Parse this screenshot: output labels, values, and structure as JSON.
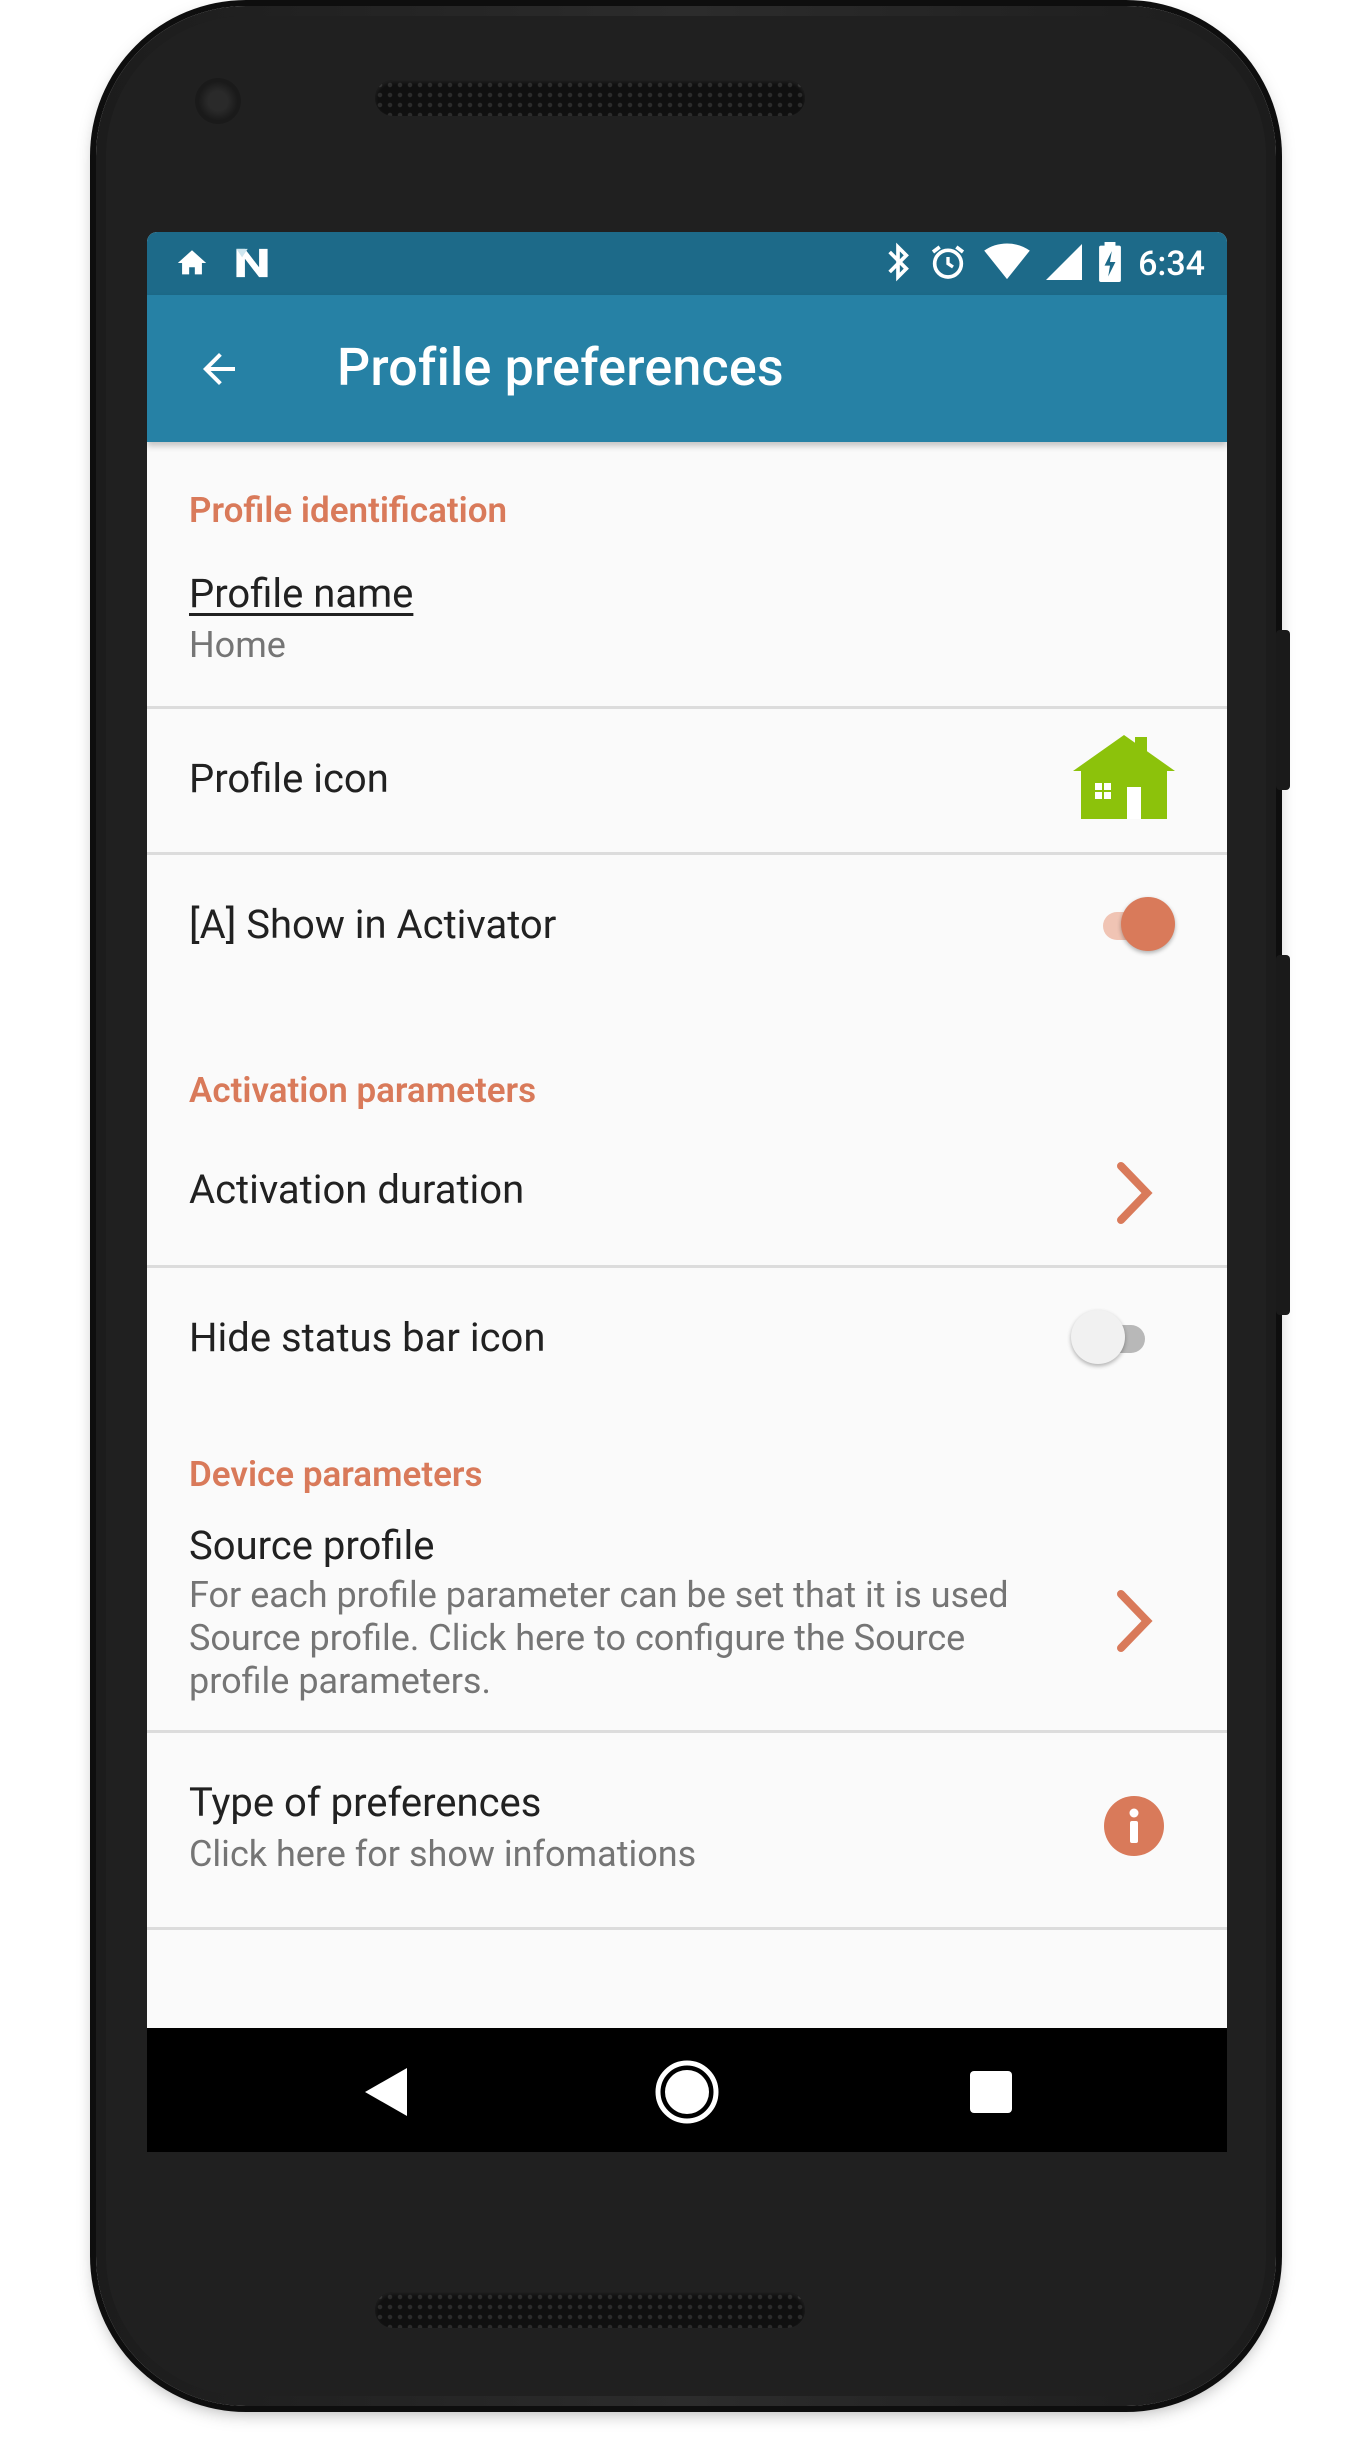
{
  "statusbar": {
    "time": "6:34",
    "left_icons": [
      "home-icon",
      "n-logo-icon"
    ],
    "right_icons": [
      "bluetooth-icon",
      "alarm-icon",
      "wifi-icon",
      "signal-icon",
      "battery-charging-icon"
    ]
  },
  "toolbar": {
    "title": "Profile preferences",
    "back_icon": "arrow-back-icon"
  },
  "sections": {
    "identification": {
      "label": "Profile identification",
      "profile_name": {
        "title": "Profile name",
        "value": "Home"
      },
      "profile_icon": {
        "title": "Profile icon",
        "icon": "house-icon"
      },
      "show_in_activator": {
        "title": "[A] Show in Activator",
        "enabled": true
      }
    },
    "activation": {
      "label": "Activation parameters",
      "activation_duration": {
        "title": "Activation duration",
        "icon": "chevron-right-icon"
      },
      "hide_status_bar_icon": {
        "title": "Hide status bar icon",
        "enabled": false
      }
    },
    "device": {
      "label": "Device parameters",
      "source_profile": {
        "title": "Source profile",
        "summary_lines": [
          "For each profile parameter can be set that it is used",
          "Source profile. Click here to configure the Source",
          "profile parameters."
        ],
        "icon": "chevron-right-icon"
      },
      "type_of_preferences": {
        "title": "Type of preferences",
        "summary": "Click here for show infomations",
        "icon": "info-icon"
      }
    }
  },
  "navbar": {
    "icons": [
      "nav-back-icon",
      "nav-home-icon",
      "nav-recents-icon"
    ]
  },
  "colors": {
    "accent": "#d97a5a",
    "toolbar": "#2681a5",
    "statusbar": "#1d6a89",
    "icon_green": "#8cc20b"
  }
}
